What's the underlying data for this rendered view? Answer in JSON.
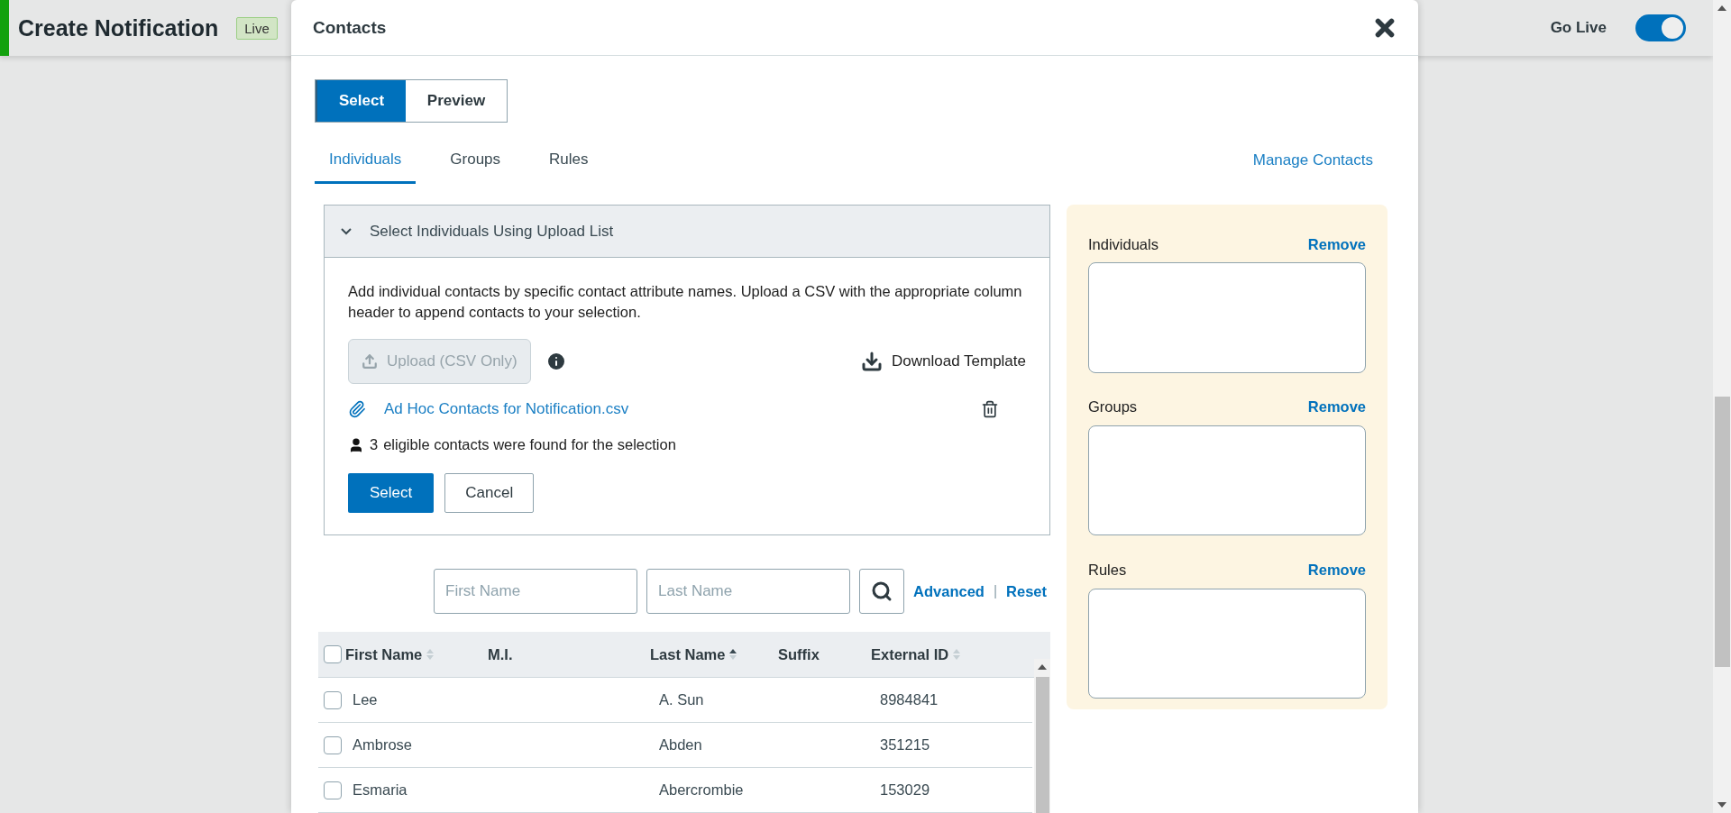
{
  "page_header": {
    "title": "Create Notification",
    "badge": "Live",
    "go_live": {
      "label": "Go Live",
      "on": true
    }
  },
  "modal": {
    "title": "Contacts",
    "mode_buttons": [
      {
        "label": "Select",
        "selected": true
      },
      {
        "label": "Preview",
        "selected": false
      }
    ],
    "tabs": [
      {
        "label": "Individuals",
        "selected": true
      },
      {
        "label": "Groups",
        "selected": false
      },
      {
        "label": "Rules",
        "selected": false
      }
    ],
    "manage_link": "Manage Contacts",
    "upload_panel": {
      "title": "Select Individuals Using Upload List",
      "expanded": true,
      "description": "Add individual contacts by specific contact attribute names. Upload a CSV with the appropriate column header to append contacts to your selection.",
      "upload_button": {
        "label": "Upload (CSV Only)",
        "disabled": true
      },
      "download_link": "Download Template",
      "file": "Ad Hoc Contacts for Notification.csv",
      "count": "3",
      "count_text": "eligible contacts were found for the selection",
      "select_button": "Select",
      "cancel_button": "Cancel"
    },
    "search": {
      "first_placeholder": "First Name",
      "last_placeholder": "Last Name",
      "advanced": "Advanced",
      "separator": "|",
      "reset": "Reset"
    },
    "table": {
      "select_all_checked": false,
      "columns": [
        {
          "label": "First Name",
          "sortable": true,
          "sorted_ascending": false
        },
        {
          "label": "M.I.",
          "sortable": false
        },
        {
          "label": "Last Name",
          "sortable": true,
          "sorted_ascending": true
        },
        {
          "label": "Suffix",
          "sortable": false
        },
        {
          "label": "External ID",
          "sortable": true,
          "sorted_ascending": false
        }
      ],
      "rows": [
        {
          "checked": false,
          "first_name": "Lee",
          "last_name": "A. Sun",
          "external_id": "8984841"
        },
        {
          "checked": false,
          "first_name": "Ambrose",
          "last_name": "Abden",
          "external_id": "351215"
        },
        {
          "checked": false,
          "first_name": "Esmaria",
          "last_name": "Abercrombie",
          "external_id": "153029"
        }
      ]
    },
    "selection_panel": {
      "sections": [
        {
          "label": "Individuals",
          "action": "Remove"
        },
        {
          "label": "Groups",
          "action": "Remove"
        },
        {
          "label": "Rules",
          "action": "Remove"
        }
      ]
    }
  }
}
